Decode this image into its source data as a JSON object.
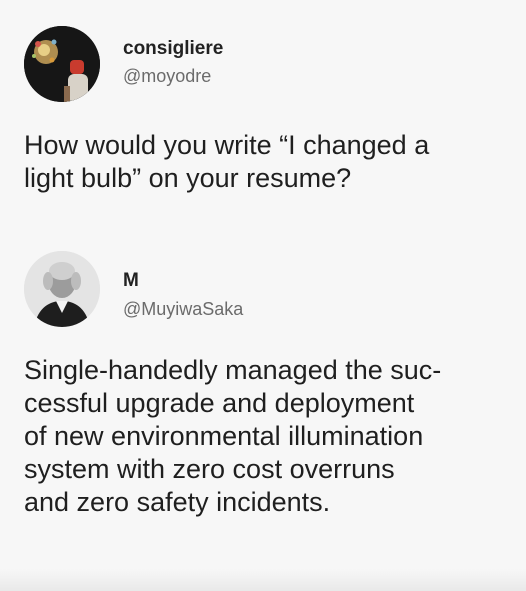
{
  "tweets": [
    {
      "display_name": "consigliere",
      "handle": "@moyodre",
      "text_lines": [
        "How would you write “I changed a",
        "light bulb” on your resume?"
      ]
    },
    {
      "display_name": "M",
      "handle": "@MuyiwaSaka",
      "text_lines": [
        "Single-handedly managed the suc-",
        "cessful upgrade and deployment",
        "of new environmental illumination",
        "system with zero cost overruns",
        "and zero safety incidents."
      ]
    }
  ],
  "colors": {
    "background": "#f7f7f7",
    "text": "#1f1f1f",
    "handle": "#6b6b6b"
  },
  "icons": {
    "avatar_1": "fireworks-portrait-avatar",
    "avatar_2": "vintage-portrait-avatar"
  }
}
